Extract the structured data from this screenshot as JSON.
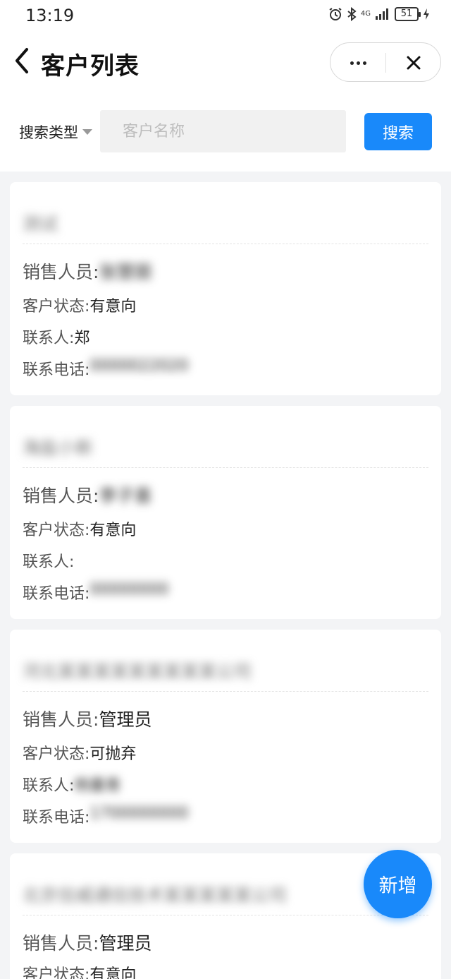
{
  "status_bar": {
    "time": "13:19",
    "battery": "51",
    "network": "4G"
  },
  "header": {
    "title": "客户列表"
  },
  "search": {
    "type_label": "搜索类型",
    "placeholder": "客户名称",
    "button_label": "搜索"
  },
  "customers": [
    {
      "name": "测试",
      "sales_label": "销售人员:",
      "sales_value": "张慧丽",
      "status_label": "客户状态:",
      "status_value": "有意向",
      "contact_label": "联系人:",
      "contact_value": "郑",
      "phone_label": "联系电话:",
      "phone_value": "0000022020"
    },
    {
      "name": "海盐小新",
      "sales_label": "销售人员:",
      "sales_value": "李子喜",
      "status_label": "客户状态:",
      "status_value": "有意向",
      "contact_label": "联系人:",
      "contact_value": "",
      "phone_label": "联系电话:",
      "phone_value": "00000000"
    },
    {
      "name": "河北某某某某某某某某某公司",
      "sales_label": "销售人员:",
      "sales_value": "管理员",
      "status_label": "客户状态:",
      "status_value": "可抛弃",
      "contact_label": "联系人:",
      "contact_value": "杨重青",
      "phone_label": "联系电话:",
      "phone_value": "1700000000"
    },
    {
      "name": "北京信威通信技术某某某某某公司",
      "sales_label": "销售人员:",
      "sales_value": "管理员",
      "status_label": "客户状态:",
      "status_value": "有意向"
    }
  ],
  "fab": {
    "label": "新增"
  }
}
